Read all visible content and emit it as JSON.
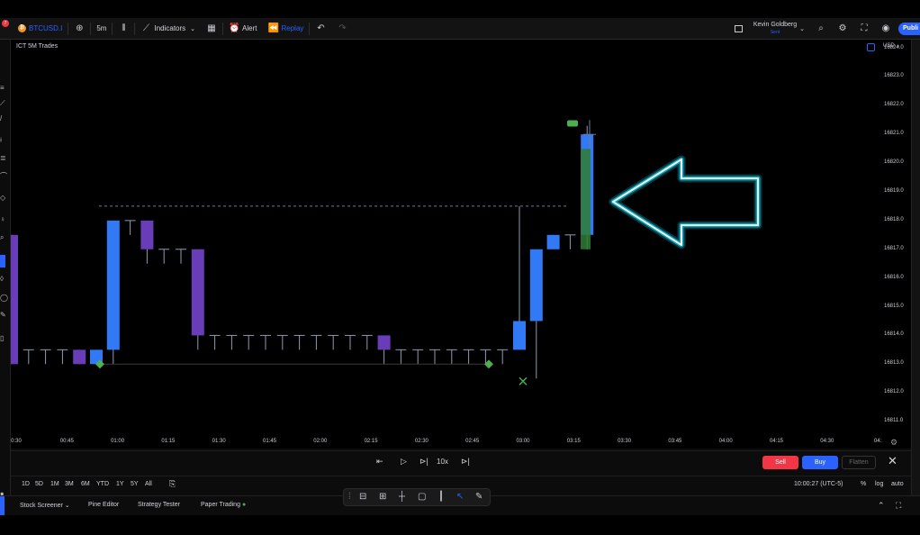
{
  "toolbar": {
    "symbol": "BTCUSD.I",
    "interval": "5m",
    "indicators_label": "Indicators",
    "alert_label": "Alert",
    "replay_label": "Replay",
    "user_name": "Kevin Goldberg",
    "user_sub": "Sent",
    "publish_label": "Publi",
    "notification_count": "7"
  },
  "chart": {
    "title": "ICT 5M Trades",
    "currency": "USD",
    "colors": {
      "bull": "#3179f5",
      "bear": "#6a3db8",
      "wick": "#8e9bb5",
      "marker": "#4caf50",
      "glow": "#18e0ff"
    }
  },
  "chart_data": {
    "type": "candlestick",
    "title": "ICT 5M Trades",
    "ylabel": "USD",
    "ylim": [
      16810.5,
      16824.3
    ],
    "y_ticks": [
      "16824.0",
      "16823.0",
      "16822.0",
      "16821.0",
      "16820.0",
      "16819.0",
      "16818.0",
      "16817.0",
      "16816.0",
      "16815.0",
      "16814.0",
      "16813.0",
      "16812.0",
      "16811.0"
    ],
    "x_ticks": [
      "0:30",
      "00:45",
      "01:00",
      "01:15",
      "01:30",
      "01:45",
      "02:00",
      "02:15",
      "02:30",
      "02:45",
      "03:00",
      "03:15",
      "03:30",
      "03:45",
      "04:00",
      "04:15",
      "04:30",
      "04:"
    ],
    "candles": [
      {
        "o": 16817.5,
        "h": 16817.5,
        "c": 16813.0,
        "l": 16813.0
      },
      {
        "o": 16813.5,
        "h": 16813.5,
        "c": 16813.5,
        "l": 16813.0
      },
      {
        "o": 16813.5,
        "h": 16813.5,
        "c": 16813.5,
        "l": 16813.0
      },
      {
        "o": 16813.5,
        "h": 16813.5,
        "c": 16813.5,
        "l": 16813.0
      },
      {
        "o": 16813.5,
        "h": 16813.5,
        "c": 16813.0,
        "l": 16813.0
      },
      {
        "o": 16813.0,
        "h": 16813.5,
        "c": 16813.5,
        "l": 16813.0
      },
      {
        "o": 16813.5,
        "h": 16818.0,
        "c": 16818.0,
        "l": 16813.0
      },
      {
        "o": 16818.0,
        "h": 16818.0,
        "c": 16818.0,
        "l": 16817.5
      },
      {
        "o": 16818.0,
        "h": 16818.0,
        "c": 16817.0,
        "l": 16816.5
      },
      {
        "o": 16817.0,
        "h": 16817.0,
        "c": 16817.0,
        "l": 16816.5
      },
      {
        "o": 16817.0,
        "h": 16817.0,
        "c": 16817.0,
        "l": 16816.5
      },
      {
        "o": 16817.0,
        "h": 16817.0,
        "c": 16814.0,
        "l": 16813.5
      },
      {
        "o": 16814.0,
        "h": 16814.0,
        "c": 16814.0,
        "l": 16813.5
      },
      {
        "o": 16814.0,
        "h": 16814.0,
        "c": 16814.0,
        "l": 16813.5
      },
      {
        "o": 16814.0,
        "h": 16814.0,
        "c": 16814.0,
        "l": 16813.5
      },
      {
        "o": 16814.0,
        "h": 16814.0,
        "c": 16814.0,
        "l": 16813.5
      },
      {
        "o": 16814.0,
        "h": 16814.0,
        "c": 16814.0,
        "l": 16813.5
      },
      {
        "o": 16814.0,
        "h": 16814.0,
        "c": 16814.0,
        "l": 16813.5
      },
      {
        "o": 16814.0,
        "h": 16814.0,
        "c": 16814.0,
        "l": 16813.5
      },
      {
        "o": 16814.0,
        "h": 16814.0,
        "c": 16814.0,
        "l": 16813.5
      },
      {
        "o": 16814.0,
        "h": 16814.0,
        "c": 16814.0,
        "l": 16813.5
      },
      {
        "o": 16814.0,
        "h": 16814.0,
        "c": 16814.0,
        "l": 16813.5
      },
      {
        "o": 16814.0,
        "h": 16814.0,
        "c": 16813.5,
        "l": 16813.0
      },
      {
        "o": 16813.5,
        "h": 16813.5,
        "c": 16813.5,
        "l": 16813.0
      },
      {
        "o": 16813.5,
        "h": 16813.5,
        "c": 16813.5,
        "l": 16813.0
      },
      {
        "o": 16813.5,
        "h": 16813.5,
        "c": 16813.5,
        "l": 16813.0
      },
      {
        "o": 16813.5,
        "h": 16813.5,
        "c": 16813.5,
        "l": 16813.0
      },
      {
        "o": 16813.5,
        "h": 16813.5,
        "c": 16813.5,
        "l": 16813.0
      },
      {
        "o": 16813.5,
        "h": 16813.5,
        "c": 16813.5,
        "l": 16813.0
      },
      {
        "o": 16813.5,
        "h": 16813.5,
        "c": 16813.5,
        "l": 16813.0
      },
      {
        "o": 16813.5,
        "h": 16818.5,
        "c": 16814.5,
        "l": 16813.5
      },
      {
        "o": 16814.5,
        "h": 16814.5,
        "c": 16817.0,
        "l": 16812.5
      },
      {
        "o": 16817.0,
        "h": 16817.5,
        "c": 16817.5,
        "l": 16817.0
      },
      {
        "o": 16817.5,
        "h": 16817.5,
        "c": 16817.5,
        "l": 16817.0
      },
      {
        "o": 16817.5,
        "h": 16821.3,
        "c": 16821.0,
        "l": 16817.0
      }
    ],
    "dashed_level": 16818.5,
    "grid": false
  },
  "replay": {
    "speed_label": "10x",
    "sell_label": "Sell",
    "buy_label": "Buy",
    "flatten_label": "Flatten"
  },
  "ranges": {
    "items": [
      "1D",
      "5D",
      "1M",
      "3M",
      "6M",
      "YTD",
      "1Y",
      "5Y",
      "All"
    ],
    "clock": "10:00:27 (UTC-5)",
    "percent_label": "%",
    "log_label": "log",
    "auto_label": "auto"
  },
  "bottom_tabs": {
    "screener": "Stock Screener",
    "pine": "Pine Editor",
    "strategy": "Strategy Tester",
    "paper": "Paper Trading"
  }
}
